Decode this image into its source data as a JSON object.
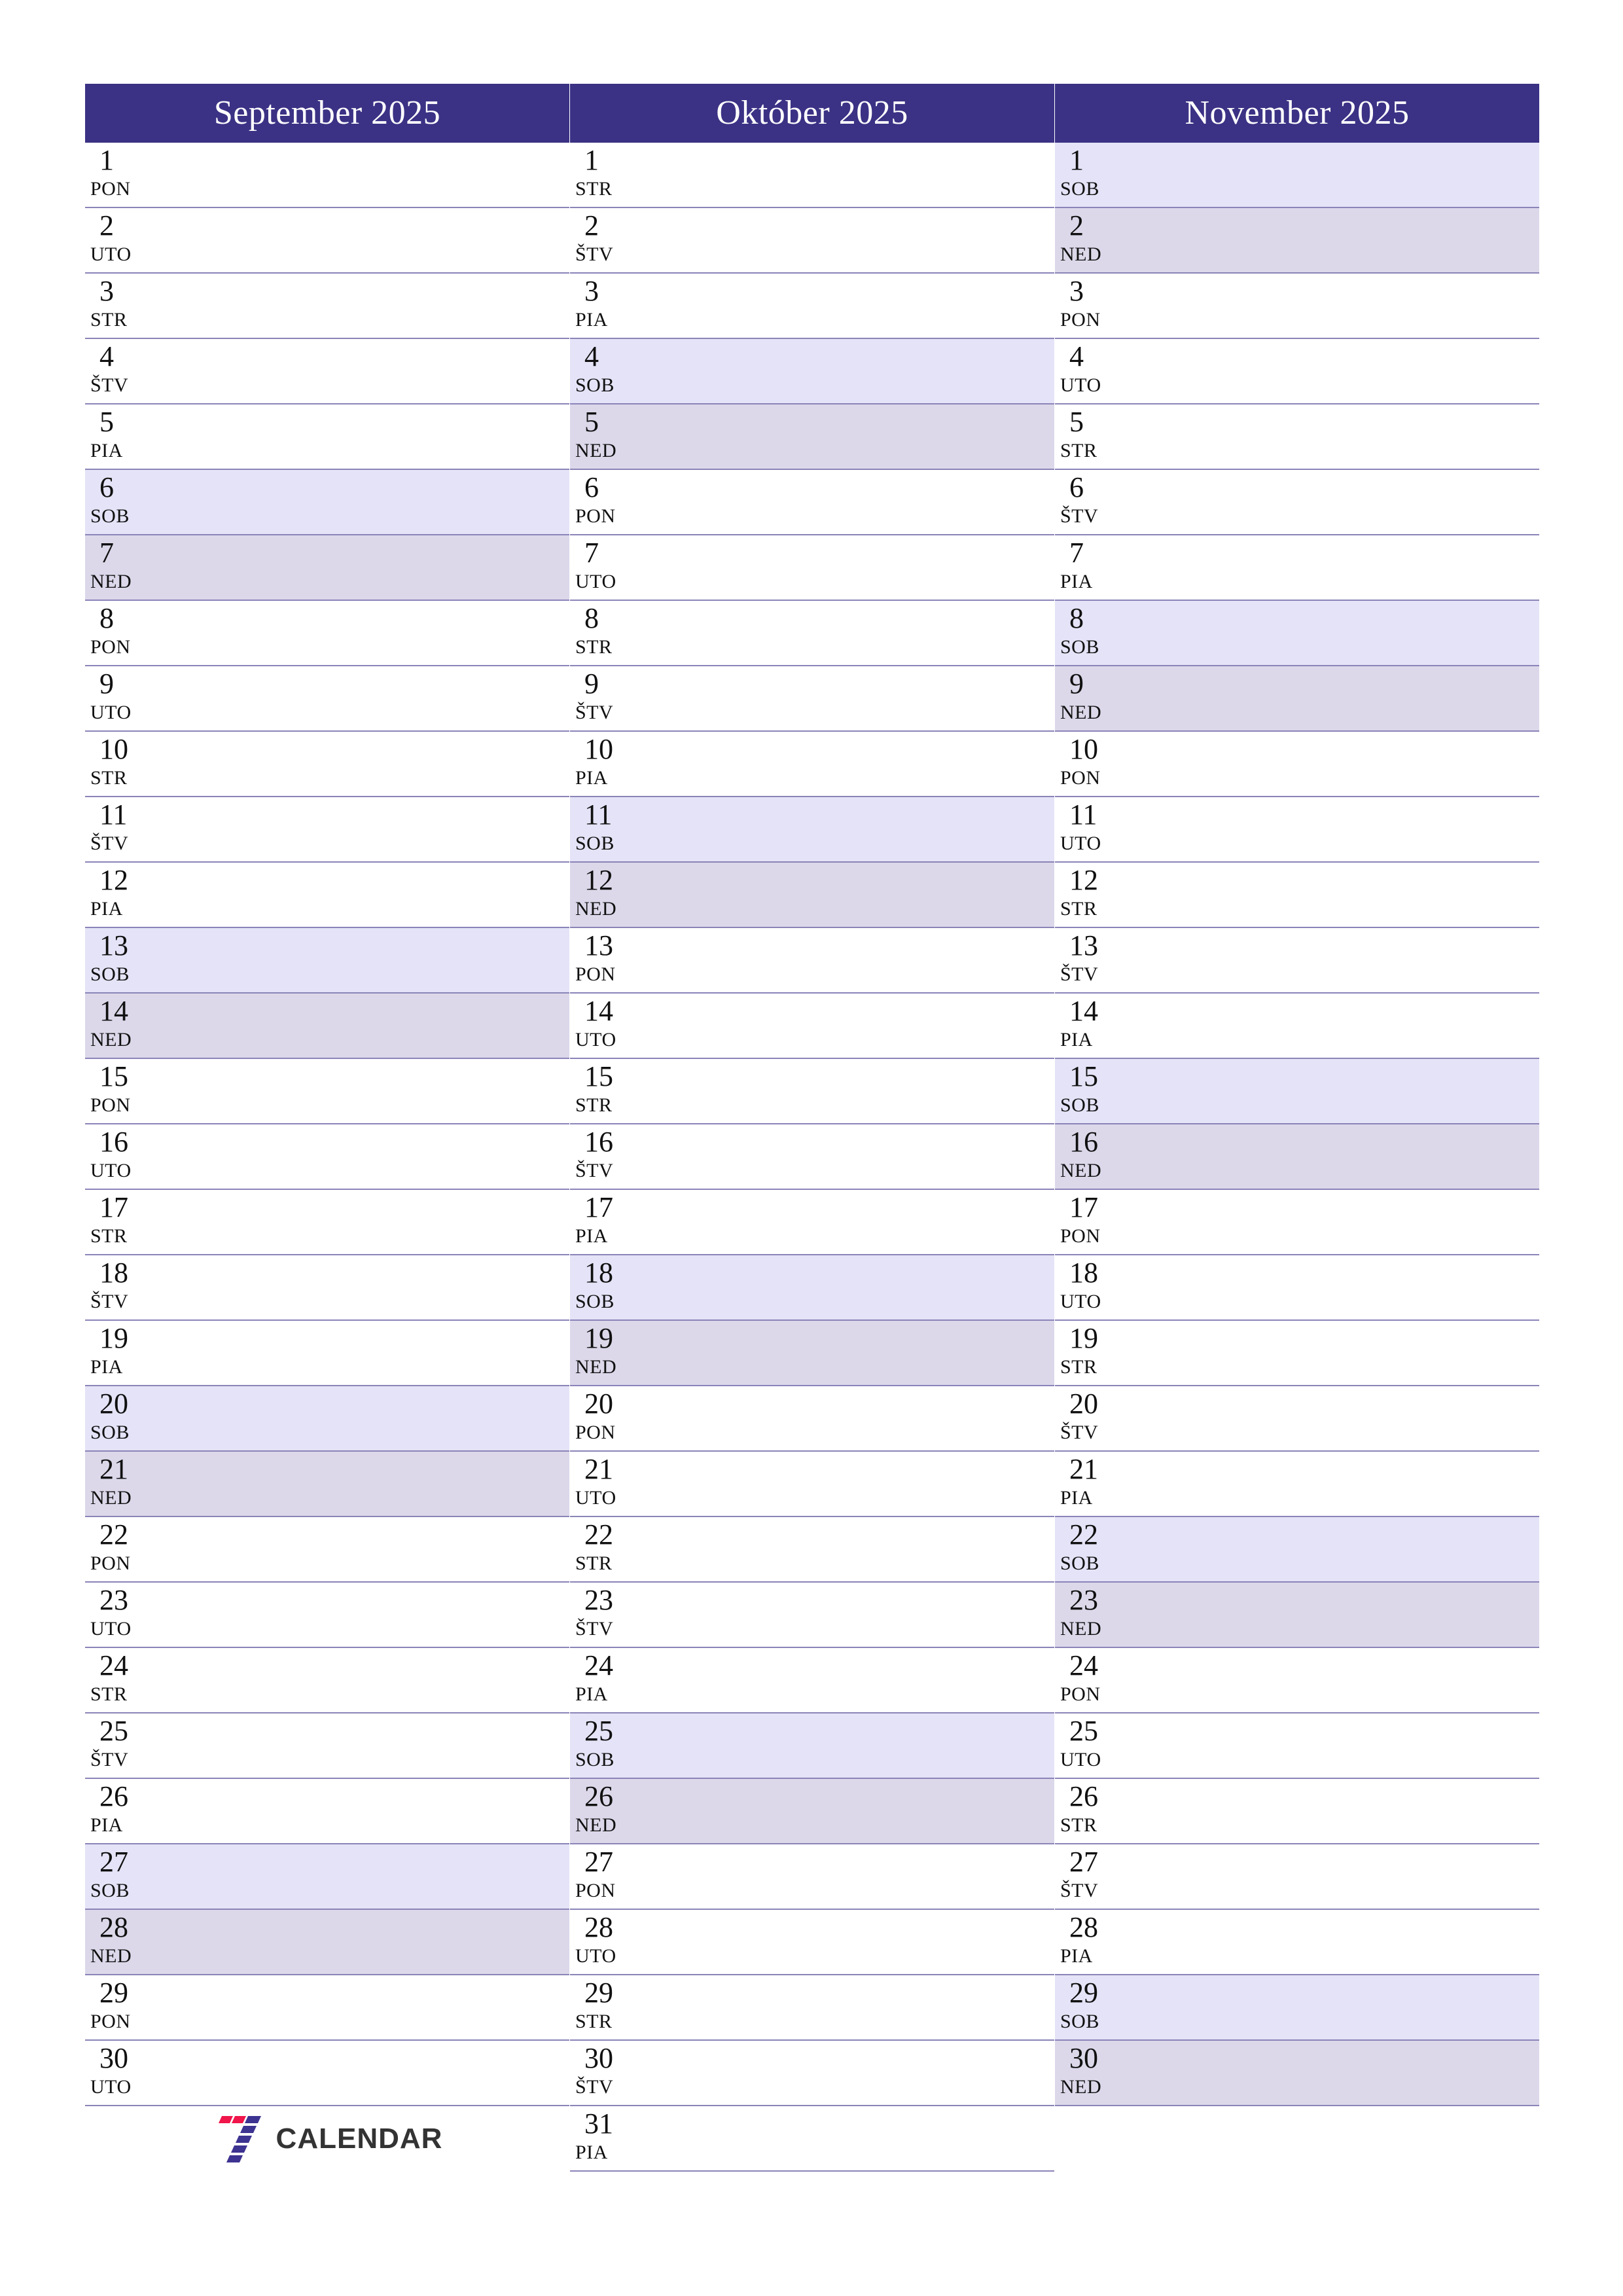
{
  "brand": {
    "logo_word": "CALENDAR",
    "logo_mark_name": "seven-logo-icon",
    "colors": {
      "header_bg": "#3b3285",
      "saturday_bg": "#e4e3f7",
      "sunday_bg": "#dcd8ea",
      "row_border": "#8a84b8",
      "logo_red": "#f0154a",
      "logo_purple": "#3d3391",
      "logo_text": "#333333"
    }
  },
  "weekday_abbr": {
    "mon": "PON",
    "tue": "UTO",
    "wed": "STR",
    "thu": "ŠTV",
    "fri": "PIA",
    "sat": "SOB",
    "sun": "NED"
  },
  "months": [
    {
      "title": "September 2025",
      "days": [
        {
          "num": "1",
          "name": "PON",
          "type": "weekday"
        },
        {
          "num": "2",
          "name": "UTO",
          "type": "weekday"
        },
        {
          "num": "3",
          "name": "STR",
          "type": "weekday"
        },
        {
          "num": "4",
          "name": "ŠTV",
          "type": "weekday"
        },
        {
          "num": "5",
          "name": "PIA",
          "type": "weekday"
        },
        {
          "num": "6",
          "name": "SOB",
          "type": "sat"
        },
        {
          "num": "7",
          "name": "NED",
          "type": "sun"
        },
        {
          "num": "8",
          "name": "PON",
          "type": "weekday"
        },
        {
          "num": "9",
          "name": "UTO",
          "type": "weekday"
        },
        {
          "num": "10",
          "name": "STR",
          "type": "weekday"
        },
        {
          "num": "11",
          "name": "ŠTV",
          "type": "weekday"
        },
        {
          "num": "12",
          "name": "PIA",
          "type": "weekday"
        },
        {
          "num": "13",
          "name": "SOB",
          "type": "sat"
        },
        {
          "num": "14",
          "name": "NED",
          "type": "sun"
        },
        {
          "num": "15",
          "name": "PON",
          "type": "weekday"
        },
        {
          "num": "16",
          "name": "UTO",
          "type": "weekday"
        },
        {
          "num": "17",
          "name": "STR",
          "type": "weekday"
        },
        {
          "num": "18",
          "name": "ŠTV",
          "type": "weekday"
        },
        {
          "num": "19",
          "name": "PIA",
          "type": "weekday"
        },
        {
          "num": "20",
          "name": "SOB",
          "type": "sat"
        },
        {
          "num": "21",
          "name": "NED",
          "type": "sun"
        },
        {
          "num": "22",
          "name": "PON",
          "type": "weekday"
        },
        {
          "num": "23",
          "name": "UTO",
          "type": "weekday"
        },
        {
          "num": "24",
          "name": "STR",
          "type": "weekday"
        },
        {
          "num": "25",
          "name": "ŠTV",
          "type": "weekday"
        },
        {
          "num": "26",
          "name": "PIA",
          "type": "weekday"
        },
        {
          "num": "27",
          "name": "SOB",
          "type": "sat"
        },
        {
          "num": "28",
          "name": "NED",
          "type": "sun"
        },
        {
          "num": "29",
          "name": "PON",
          "type": "weekday"
        },
        {
          "num": "30",
          "name": "UTO",
          "type": "weekday"
        }
      ],
      "trailing_slots": 1,
      "has_logo": true
    },
    {
      "title": "Október 2025",
      "days": [
        {
          "num": "1",
          "name": "STR",
          "type": "weekday"
        },
        {
          "num": "2",
          "name": "ŠTV",
          "type": "weekday"
        },
        {
          "num": "3",
          "name": "PIA",
          "type": "weekday"
        },
        {
          "num": "4",
          "name": "SOB",
          "type": "sat"
        },
        {
          "num": "5",
          "name": "NED",
          "type": "sun"
        },
        {
          "num": "6",
          "name": "PON",
          "type": "weekday"
        },
        {
          "num": "7",
          "name": "UTO",
          "type": "weekday"
        },
        {
          "num": "8",
          "name": "STR",
          "type": "weekday"
        },
        {
          "num": "9",
          "name": "ŠTV",
          "type": "weekday"
        },
        {
          "num": "10",
          "name": "PIA",
          "type": "weekday"
        },
        {
          "num": "11",
          "name": "SOB",
          "type": "sat"
        },
        {
          "num": "12",
          "name": "NED",
          "type": "sun"
        },
        {
          "num": "13",
          "name": "PON",
          "type": "weekday"
        },
        {
          "num": "14",
          "name": "UTO",
          "type": "weekday"
        },
        {
          "num": "15",
          "name": "STR",
          "type": "weekday"
        },
        {
          "num": "16",
          "name": "ŠTV",
          "type": "weekday"
        },
        {
          "num": "17",
          "name": "PIA",
          "type": "weekday"
        },
        {
          "num": "18",
          "name": "SOB",
          "type": "sat"
        },
        {
          "num": "19",
          "name": "NED",
          "type": "sun"
        },
        {
          "num": "20",
          "name": "PON",
          "type": "weekday"
        },
        {
          "num": "21",
          "name": "UTO",
          "type": "weekday"
        },
        {
          "num": "22",
          "name": "STR",
          "type": "weekday"
        },
        {
          "num": "23",
          "name": "ŠTV",
          "type": "weekday"
        },
        {
          "num": "24",
          "name": "PIA",
          "type": "weekday"
        },
        {
          "num": "25",
          "name": "SOB",
          "type": "sat"
        },
        {
          "num": "26",
          "name": "NED",
          "type": "sun"
        },
        {
          "num": "27",
          "name": "PON",
          "type": "weekday"
        },
        {
          "num": "28",
          "name": "UTO",
          "type": "weekday"
        },
        {
          "num": "29",
          "name": "STR",
          "type": "weekday"
        },
        {
          "num": "30",
          "name": "ŠTV",
          "type": "weekday"
        },
        {
          "num": "31",
          "name": "PIA",
          "type": "weekday"
        }
      ],
      "trailing_slots": 0,
      "has_logo": false
    },
    {
      "title": "November 2025",
      "days": [
        {
          "num": "1",
          "name": "SOB",
          "type": "sat"
        },
        {
          "num": "2",
          "name": "NED",
          "type": "sun"
        },
        {
          "num": "3",
          "name": "PON",
          "type": "weekday"
        },
        {
          "num": "4",
          "name": "UTO",
          "type": "weekday"
        },
        {
          "num": "5",
          "name": "STR",
          "type": "weekday"
        },
        {
          "num": "6",
          "name": "ŠTV",
          "type": "weekday"
        },
        {
          "num": "7",
          "name": "PIA",
          "type": "weekday"
        },
        {
          "num": "8",
          "name": "SOB",
          "type": "sat"
        },
        {
          "num": "9",
          "name": "NED",
          "type": "sun"
        },
        {
          "num": "10",
          "name": "PON",
          "type": "weekday"
        },
        {
          "num": "11",
          "name": "UTO",
          "type": "weekday"
        },
        {
          "num": "12",
          "name": "STR",
          "type": "weekday"
        },
        {
          "num": "13",
          "name": "ŠTV",
          "type": "weekday"
        },
        {
          "num": "14",
          "name": "PIA",
          "type": "weekday"
        },
        {
          "num": "15",
          "name": "SOB",
          "type": "sat"
        },
        {
          "num": "16",
          "name": "NED",
          "type": "sun"
        },
        {
          "num": "17",
          "name": "PON",
          "type": "weekday"
        },
        {
          "num": "18",
          "name": "UTO",
          "type": "weekday"
        },
        {
          "num": "19",
          "name": "STR",
          "type": "weekday"
        },
        {
          "num": "20",
          "name": "ŠTV",
          "type": "weekday"
        },
        {
          "num": "21",
          "name": "PIA",
          "type": "weekday"
        },
        {
          "num": "22",
          "name": "SOB",
          "type": "sat"
        },
        {
          "num": "23",
          "name": "NED",
          "type": "sun"
        },
        {
          "num": "24",
          "name": "PON",
          "type": "weekday"
        },
        {
          "num": "25",
          "name": "UTO",
          "type": "weekday"
        },
        {
          "num": "26",
          "name": "STR",
          "type": "weekday"
        },
        {
          "num": "27",
          "name": "ŠTV",
          "type": "weekday"
        },
        {
          "num": "28",
          "name": "PIA",
          "type": "weekday"
        },
        {
          "num": "29",
          "name": "SOB",
          "type": "sat"
        },
        {
          "num": "30",
          "name": "NED",
          "type": "sun"
        }
      ],
      "trailing_slots": 1,
      "has_logo": false
    }
  ]
}
